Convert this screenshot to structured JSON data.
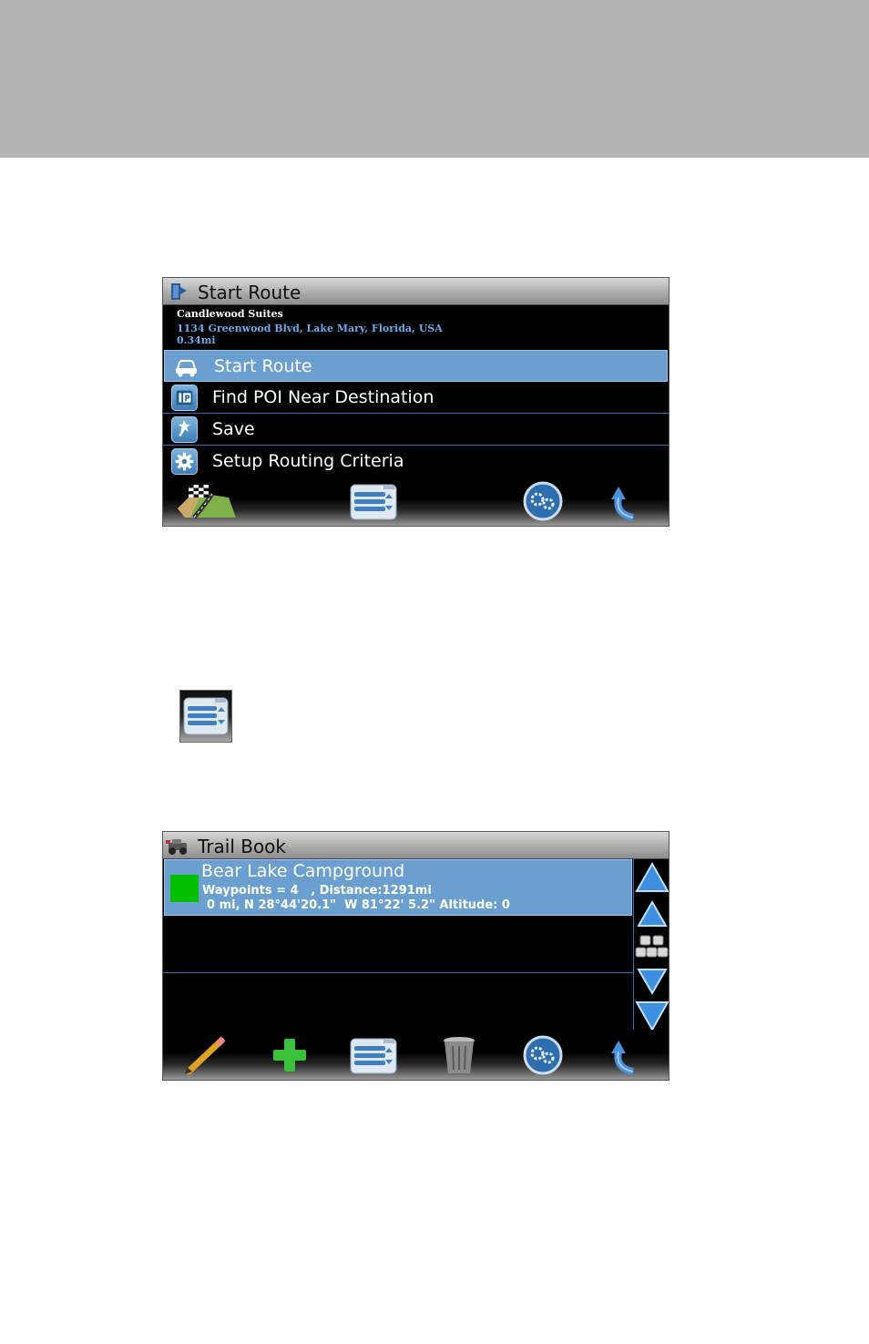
{
  "start_route_screen": {
    "title": "Start Route",
    "destination": {
      "name": "Candlewood Suites",
      "address": "1134 Greenwood Blvd, Lake Mary, Florida, USA",
      "distance": "0.34mi"
    },
    "menu": [
      {
        "label": "Start Route",
        "icon": "car-icon"
      },
      {
        "label": "Find POI Near Destination",
        "icon": "poi-icon"
      },
      {
        "label": "Save",
        "icon": "save-pin-icon"
      },
      {
        "label": "Setup Routing Criteria",
        "icon": "gear-icon"
      }
    ],
    "toolbar": [
      "route-map-icon",
      "list-icon",
      "settings-icon",
      "back-icon"
    ]
  },
  "trail_book_screen": {
    "title": "Trail Book",
    "items": [
      {
        "name": "Bear Lake Campground",
        "details": "Waypoints = 4   , Distance:1291mi",
        "location": "0 mi, N 28°44'20.1\"  W 81°22' 5.2\" Altitude: 0",
        "color": "#00c000"
      }
    ],
    "scroll_buttons": [
      "page-up-icon",
      "up-icon",
      "keyboard-icon",
      "down-icon",
      "page-down-icon"
    ],
    "toolbar": [
      "pencil-icon",
      "add-icon",
      "list-icon",
      "trash-icon",
      "settings-icon",
      "back-icon"
    ]
  },
  "colors": {
    "highlight": "#6a9fd0",
    "divider": "#3d6fa8",
    "address_text": "#6fa8e8",
    "swatch_green": "#00c000"
  }
}
